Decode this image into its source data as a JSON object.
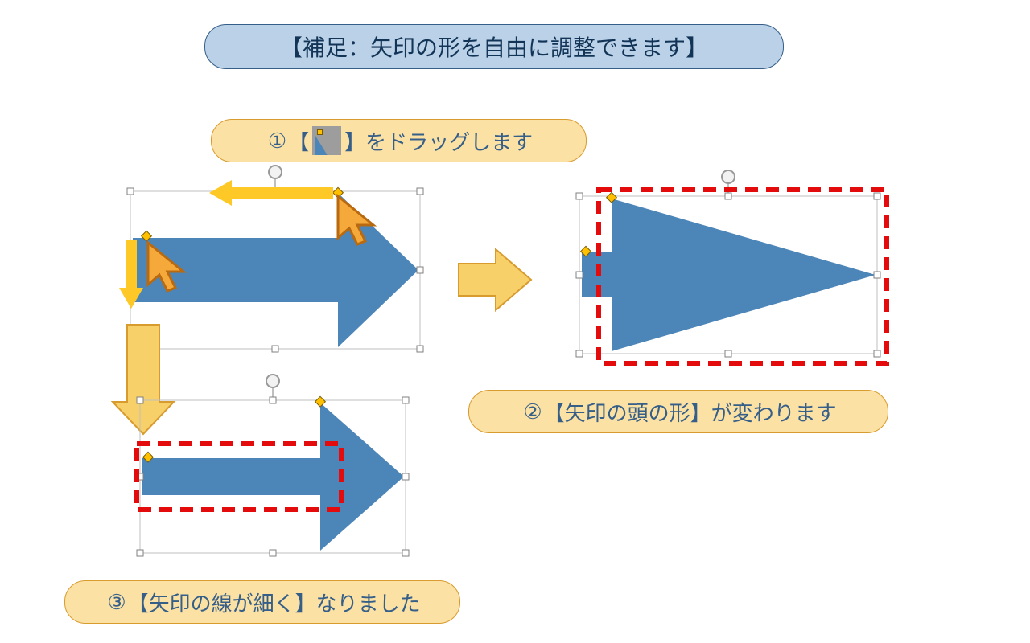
{
  "title": "【補足：矢印の形を自由に調整できます】",
  "step1": {
    "seq": "①",
    "open": "【",
    "close": "】",
    "tail": "をドラッグします",
    "icon": "adjust-handle-icon"
  },
  "step2": {
    "seq": "②",
    "text": "【矢印の頭の形】が変わります"
  },
  "step3": {
    "seq": "③",
    "text": "【矢印の線が細く】なりました"
  },
  "colors": {
    "blue": "#4C85B8",
    "yellow_fill": "#F7D069",
    "yellow_bg": "#FBE1A4",
    "yellow_stroke": "#D89B2E",
    "orange": "#ED7D31",
    "handle_line": "#BFBFBF",
    "adjust_handle": "#FFC000",
    "red_dash": "#E30B0B"
  },
  "alt": {
    "cursor": "↖",
    "rotate": "⟳"
  }
}
